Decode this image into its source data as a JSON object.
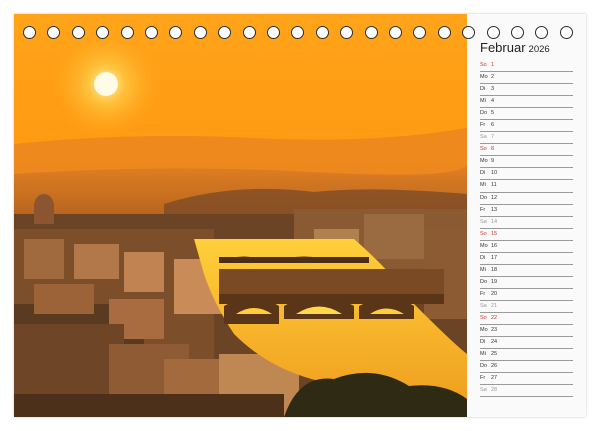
{
  "calendar": {
    "month": "Februar",
    "year": "2026",
    "days": [
      {
        "wd": "So",
        "d": "1",
        "type": "sun"
      },
      {
        "wd": "Mo",
        "d": "2",
        "type": ""
      },
      {
        "wd": "Di",
        "d": "3",
        "type": ""
      },
      {
        "wd": "Mi",
        "d": "4",
        "type": ""
      },
      {
        "wd": "Do",
        "d": "5",
        "type": ""
      },
      {
        "wd": "Fr",
        "d": "6",
        "type": ""
      },
      {
        "wd": "Sa",
        "d": "7",
        "type": "sat"
      },
      {
        "wd": "So",
        "d": "8",
        "type": "sun"
      },
      {
        "wd": "Mo",
        "d": "9",
        "type": ""
      },
      {
        "wd": "Di",
        "d": "10",
        "type": ""
      },
      {
        "wd": "Mi",
        "d": "11",
        "type": ""
      },
      {
        "wd": "Do",
        "d": "12",
        "type": ""
      },
      {
        "wd": "Fr",
        "d": "13",
        "type": ""
      },
      {
        "wd": "Sa",
        "d": "14",
        "type": "sat"
      },
      {
        "wd": "So",
        "d": "15",
        "type": "sun"
      },
      {
        "wd": "Mo",
        "d": "16",
        "type": ""
      },
      {
        "wd": "Di",
        "d": "17",
        "type": ""
      },
      {
        "wd": "Mi",
        "d": "18",
        "type": ""
      },
      {
        "wd": "Do",
        "d": "19",
        "type": ""
      },
      {
        "wd": "Fr",
        "d": "20",
        "type": ""
      },
      {
        "wd": "Sa",
        "d": "21",
        "type": "sat"
      },
      {
        "wd": "So",
        "d": "22",
        "type": "sun"
      },
      {
        "wd": "Mo",
        "d": "23",
        "type": ""
      },
      {
        "wd": "Di",
        "d": "24",
        "type": ""
      },
      {
        "wd": "Mi",
        "d": "25",
        "type": ""
      },
      {
        "wd": "Do",
        "d": "26",
        "type": ""
      },
      {
        "wd": "Fr",
        "d": "27",
        "type": ""
      },
      {
        "wd": "Sa",
        "d": "28",
        "type": "sat"
      }
    ]
  },
  "binding": {
    "ring_count": 23
  },
  "colors": {
    "sunday": "#c0392b",
    "saturday": "#9a9a9a",
    "sky_top": "#ff9d10",
    "sky_bottom": "#f08a1a"
  }
}
